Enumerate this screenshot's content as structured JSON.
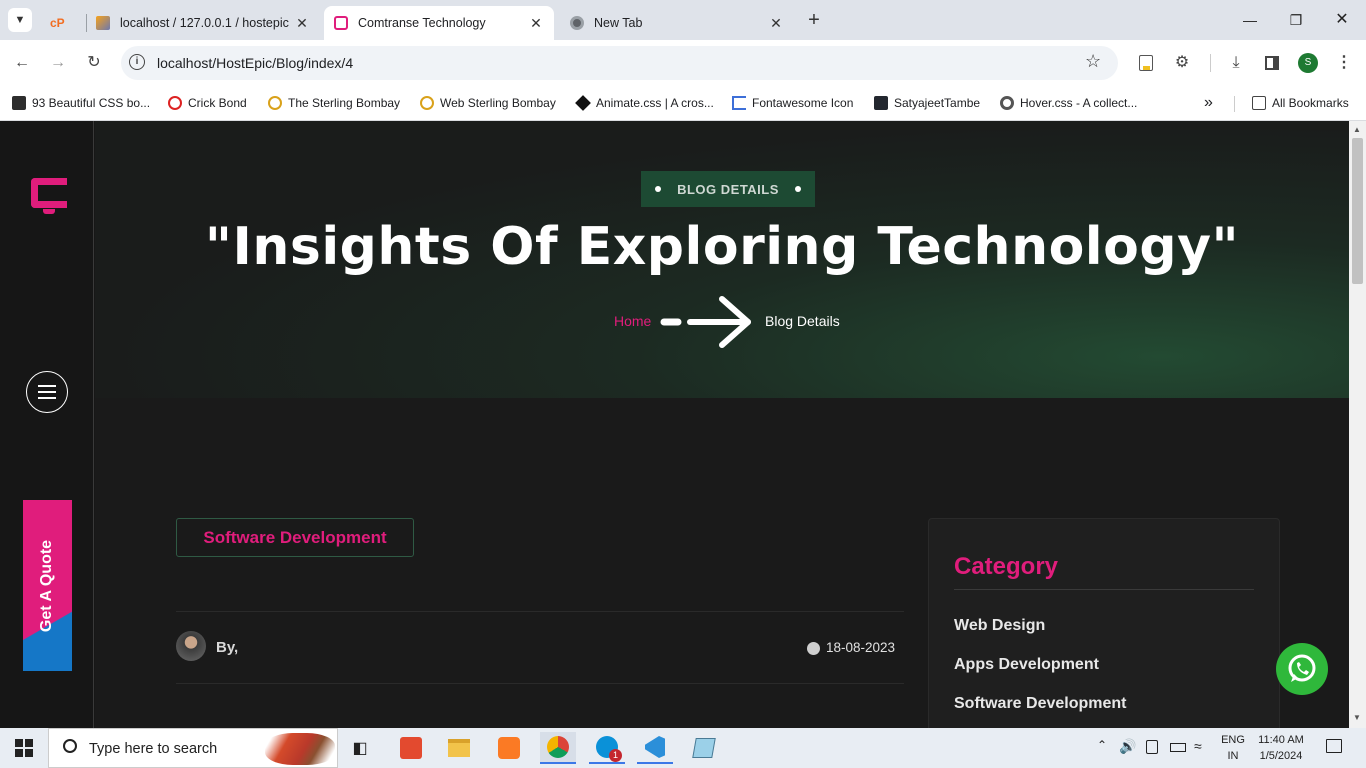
{
  "browser": {
    "tabs": [
      {
        "title": ""
      },
      {
        "title": "localhost / 127.0.0.1 / hostepic"
      },
      {
        "title": "Comtranse Technology"
      },
      {
        "title": "New Tab"
      }
    ],
    "url": "localhost/HostEpic/Blog/index/4",
    "profile_initial": "S",
    "bookmarks": [
      "93 Beautiful CSS bo...",
      "Crick Bond",
      "The Sterling Bombay",
      "Web Sterling Bombay",
      "Animate.css | A cros...",
      "Fontawesome Icon",
      "SatyajeetTambe",
      "Hover.css - A collect..."
    ],
    "all_bookmarks": "All Bookmarks"
  },
  "site": {
    "logo_letter": "C",
    "get_quote": "Get A Quote",
    "hero": {
      "badge": "BLOG DETAILS",
      "title": "\"Insights Of Exploring Technology\"",
      "breadcrumb_home": "Home",
      "breadcrumb_current": "Blog Details"
    },
    "post": {
      "category_tag": "Software Development",
      "author": "By,",
      "date": "18-08-2023"
    },
    "category_widget": {
      "title": "Category",
      "items": [
        "Web Design",
        "Apps Development",
        "Software Development"
      ]
    }
  },
  "taskbar": {
    "search_placeholder": "Type here to search",
    "lang": "ENG",
    "region": "IN",
    "time": "11:40 AM",
    "date": "1/5/2024",
    "skype_badge": "1"
  },
  "colors": {
    "accent_pink": "#e01d7c",
    "accent_green": "#1d4a33",
    "whatsapp_green": "#2fb83b",
    "quote_blue": "#1577c7"
  }
}
